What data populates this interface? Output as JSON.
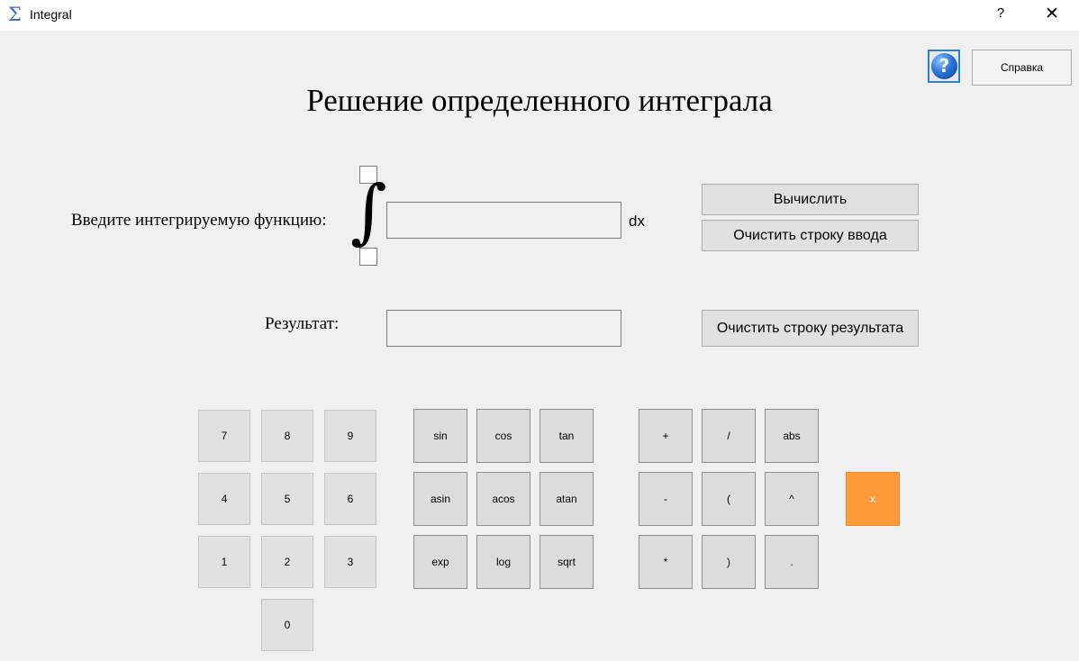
{
  "window": {
    "title": "Integral",
    "app_icon": "Σ",
    "help_glyph": "?",
    "close_glyph": "✕"
  },
  "toolbar": {
    "help_icon_glyph": "?",
    "help_button_label": "Справка"
  },
  "page_title": "Решение определенного интеграла",
  "function_input": {
    "label": "Введите интегрируемую функцию:",
    "integral_symbol": "∫",
    "value": "",
    "differential": "dx"
  },
  "result": {
    "label": "Результат:",
    "value": ""
  },
  "actions": {
    "calculate": "Вычислить",
    "clear_input": "Очистить строку ввода",
    "clear_result": "Очистить строку результата"
  },
  "keypad": {
    "digits": [
      "7",
      "8",
      "9",
      "4",
      "5",
      "6",
      "1",
      "2",
      "3",
      "0"
    ],
    "functions": [
      "sin",
      "cos",
      "tan",
      "asin",
      "acos",
      "atan",
      "exp",
      "log",
      "sqrt"
    ],
    "operators": [
      "+",
      "/",
      "abs",
      "-",
      "(",
      "^",
      "*",
      ")",
      "."
    ],
    "variable": "x"
  },
  "colors": {
    "accent_variable_key": "#ff9a3c",
    "help_icon": "#2d77d8"
  }
}
